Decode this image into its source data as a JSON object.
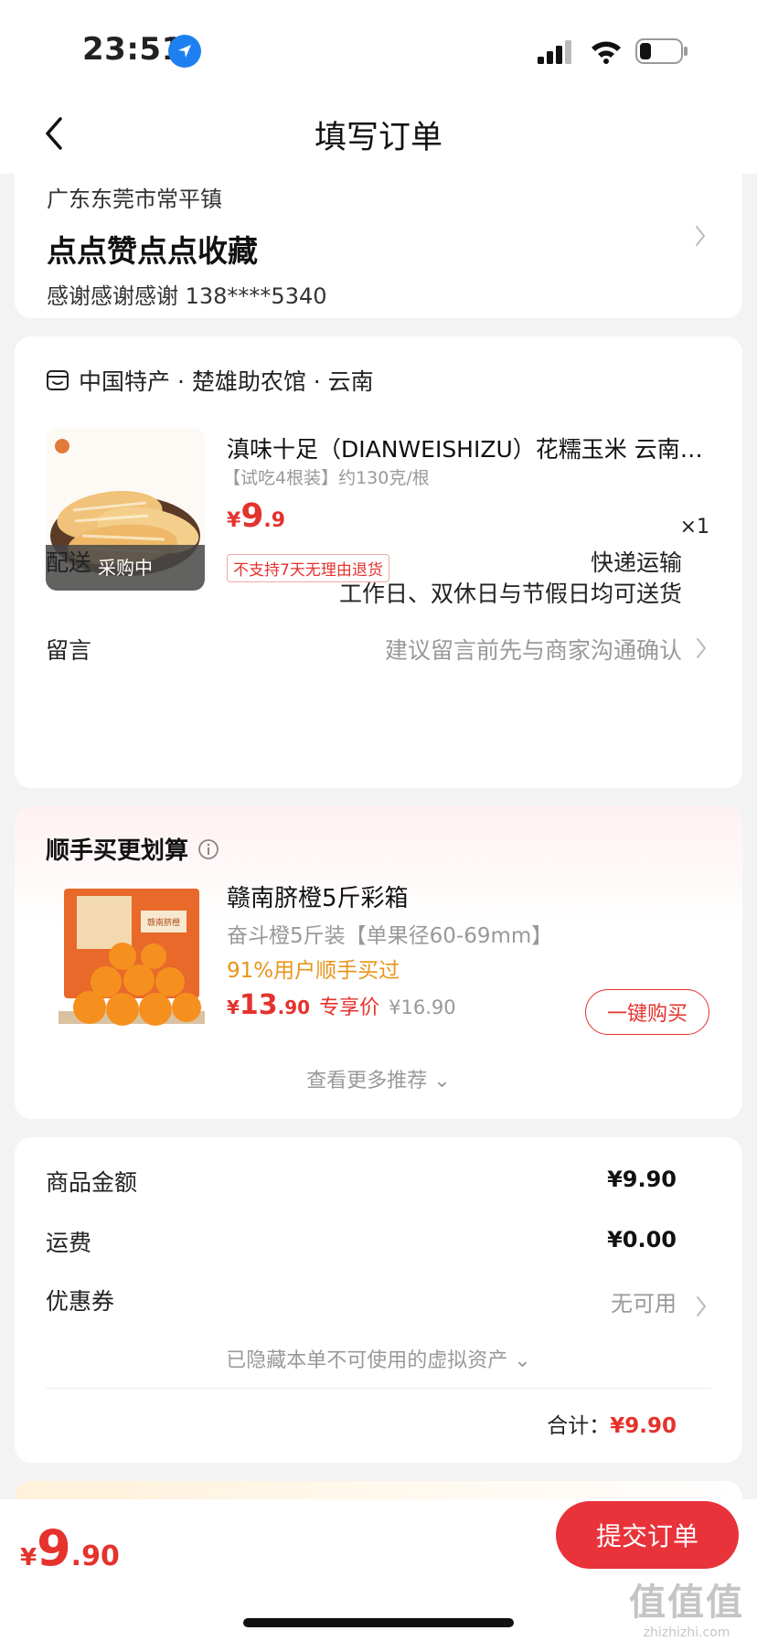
{
  "status_bar": {
    "time": "23:51"
  },
  "nav": {
    "title": "填写订单"
  },
  "address": {
    "region": "广东东莞市常平镇",
    "detail": "点点赞点点收藏",
    "contact": "感谢感谢感谢  138****5340"
  },
  "order": {
    "shop_name": "中国特产 · 楚雄助农馆 · 云南",
    "product": {
      "title": "滇味十足（DIANWEISHIZU）花糯玉米 云南西双版纳 农家",
      "spec": "【试吃4根装】约130克/根",
      "price_yen": "¥",
      "price_int": "9",
      "price_dec": ".9",
      "quantity": "×1",
      "badge": "采购中",
      "return_policy": "不支持7天无理由退货"
    },
    "delivery_label": "配送",
    "delivery_mode": "快递运输",
    "delivery_note": "工作日、双休日与节假日均可送货",
    "message_label": "留言",
    "message_placeholder": "建议留言前先与商家沟通确认"
  },
  "upsell": {
    "title": "顺手买更划算",
    "item": {
      "title": "赣南脐橙5斤彩箱",
      "spec": "奋斗橙5斤装【单果径60-69mm】",
      "social_proof": "91%用户顺手买过",
      "price_yen": "¥",
      "price_int": "13",
      "price_dec": ".90",
      "price_tag": "专享价",
      "original_price": "¥16.90",
      "buy_label": "一键购买",
      "box_label": "赣南脐橙"
    },
    "more_label": "查看更多推荐 ⌄"
  },
  "summary": {
    "goods_label": "商品金额",
    "goods_value": "¥9.90",
    "shipping_label": "运费",
    "shipping_value": "¥0.00",
    "coupon_label": "优惠券",
    "coupon_value": "无可用",
    "hidden_assets": "已隐藏本单不可使用的虚拟资产 ⌄",
    "total_label": "合计：",
    "total_value": "¥9.90"
  },
  "bottom": {
    "price_yen": "¥",
    "price_int": "9",
    "price_dec": ".90",
    "submit_label": "提交订单"
  },
  "watermark": {
    "logo": "值值值",
    "url": "zhizhizhi.com"
  },
  "colors": {
    "accent": "#e5322d",
    "submit": "#e8333b",
    "social": "#e8941a",
    "muted": "#999999"
  }
}
